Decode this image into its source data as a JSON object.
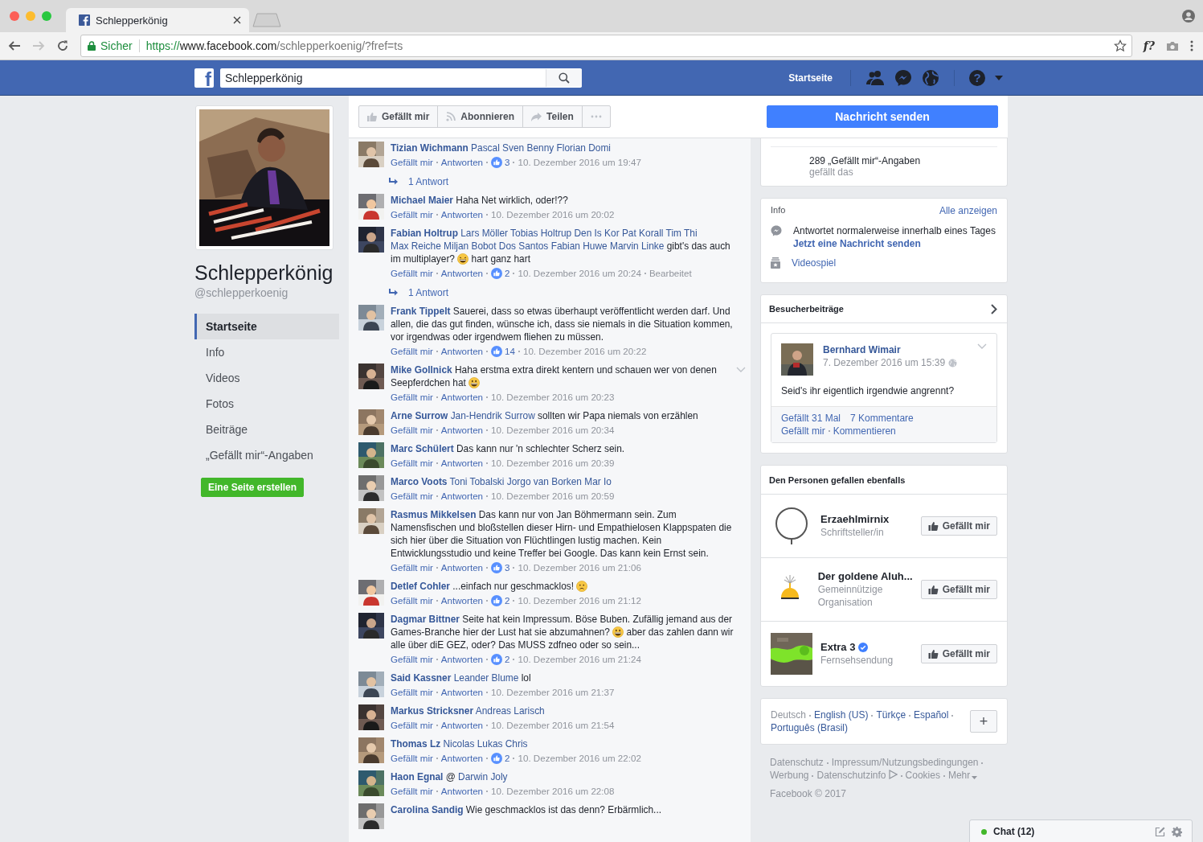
{
  "browser": {
    "tab": {
      "title": "Schlepperkönig"
    },
    "nav_buttons": [
      {
        "kind": "back",
        "disabled": false
      },
      {
        "kind": "forward",
        "disabled": true
      },
      {
        "kind": "reload",
        "disabled": false
      }
    ],
    "security": "Sicher",
    "url": {
      "scheme": "https://",
      "host": "www.facebook.com",
      "path": "/schlepperkoenig/?fref=ts"
    },
    "extension": "f?"
  },
  "topbar": {
    "logo": "f",
    "search": {
      "value": "Schlepperkönig"
    },
    "home": "Startseite",
    "help": "?"
  },
  "page": {
    "name": "Schlepperkönig",
    "handle": "@schlepperkoenig",
    "nav": [
      {
        "label": "Startseite",
        "selected": true
      },
      {
        "label": "Info",
        "selected": false
      },
      {
        "label": "Videos",
        "selected": false
      },
      {
        "label": "Fotos",
        "selected": false
      },
      {
        "label": "Beiträge",
        "selected": false
      },
      {
        "label": "„Gefällt mir“-Angaben",
        "selected": false
      }
    ],
    "create_button": "Eine Seite erstellen"
  },
  "actions": {
    "buttons": [
      {
        "kind": "like",
        "label": "Gefällt mir"
      },
      {
        "kind": "follow",
        "label": "Abonnieren"
      },
      {
        "kind": "share",
        "label": "Teilen"
      },
      {
        "kind": "more"
      }
    ],
    "message_button": "Nachricht senden"
  },
  "comments": [
    {
      "author": "Tizian Wichmann",
      "body": [
        {
          "kind": "mention",
          "text": "Pascal Sven"
        },
        {
          "kind": "mention",
          "text": "Benny Florian"
        },
        {
          "kind": "mention",
          "text": "Domi"
        }
      ],
      "meta": {
        "like": "Gefällt mir",
        "reply": "Antworten",
        "reactions": "3",
        "time": "10. Dezember 2016 um 19:47"
      },
      "replies": "1 Antwort",
      "options_shown": false
    },
    {
      "author": "Michael Maier",
      "body": [
        {
          "kind": "text",
          "text": "Haha Net wirklich, oder!??"
        }
      ],
      "meta": {
        "like": "Gefällt mir",
        "reply": "Antworten",
        "time": "10. Dezember 2016 um 20:02"
      },
      "options_shown": false
    },
    {
      "author": "Fabian Holtrup",
      "body": [
        {
          "kind": "mention",
          "text": "Lars Möller"
        },
        {
          "kind": "mention",
          "text": "Tobias Holtrup"
        },
        {
          "kind": "mention",
          "text": "Den Is Kor"
        },
        {
          "kind": "mention",
          "text": "Pat Korall"
        },
        {
          "kind": "mention",
          "text": "Tim Thi"
        },
        {
          "kind": "mention",
          "text": "Max Reiche"
        },
        {
          "kind": "mention",
          "text": "Miljan Bobot"
        },
        {
          "kind": "mention",
          "text": "Dos Santos"
        },
        {
          "kind": "mention",
          "text": "Fabian Huwe"
        },
        {
          "kind": "mention",
          "text": "Marvin Linke"
        },
        {
          "kind": "text",
          "text": "gibt's das auch im multiplayer?"
        },
        {
          "kind": "laughing"
        },
        {
          "kind": "text",
          "text": "hart ganz hart"
        }
      ],
      "meta": {
        "like": "Gefällt mir",
        "reply": "Antworten",
        "reactions": "2",
        "time": "10. Dezember 2016 um 20:24",
        "edited": "Bearbeitet"
      },
      "replies": "1 Antwort",
      "options_shown": false
    },
    {
      "author": "Frank Tippelt",
      "body": [
        {
          "kind": "text",
          "text": "Sauerei, dass so etwas überhaupt veröffentlicht werden darf. Und allen, die das gut finden, wünsche ich, dass sie niemals in die Situation kommen, vor irgendwas oder irgendwem fliehen zu müssen."
        }
      ],
      "meta": {
        "like": "Gefällt mir",
        "reply": "Antworten",
        "reactions": "14",
        "time": "10. Dezember 2016 um 20:22"
      },
      "options_shown": false
    },
    {
      "author": "Mike Gollnick",
      "body": [
        {
          "kind": "text",
          "text": "Haha erstma extra direkt kentern und schauen wer von denen Seepferdchen hat"
        },
        {
          "kind": "grinning"
        }
      ],
      "meta": {
        "like": "Gefällt mir",
        "reply": "Antworten",
        "time": "10. Dezember 2016 um 20:23"
      },
      "options_shown": true
    },
    {
      "author": "Arne Surrow",
      "body": [
        {
          "kind": "mention",
          "text": "Jan-Hendrik Surrow"
        },
        {
          "kind": "text",
          "text": "sollten wir Papa niemals von erzählen"
        }
      ],
      "meta": {
        "like": "Gefällt mir",
        "reply": "Antworten",
        "time": "10. Dezember 2016 um 20:34"
      },
      "options_shown": false
    },
    {
      "author": "Marc Schülert",
      "body": [
        {
          "kind": "text",
          "text": "Das kann nur 'n schlechter Scherz sein."
        }
      ],
      "meta": {
        "like": "Gefällt mir",
        "reply": "Antworten",
        "time": "10. Dezember 2016 um 20:39"
      },
      "options_shown": false
    },
    {
      "author": "Marco Voots",
      "body": [
        {
          "kind": "mention",
          "text": "Toni Tobalski"
        },
        {
          "kind": "mention",
          "text": "Jorgo van Borken"
        },
        {
          "kind": "mention",
          "text": "Mar Io"
        }
      ],
      "meta": {
        "like": "Gefällt mir",
        "reply": "Antworten",
        "time": "10. Dezember 2016 um 20:59"
      },
      "options_shown": false
    },
    {
      "author": "Rasmus Mikkelsen",
      "body": [
        {
          "kind": "text",
          "text": "Das kann nur von Jan Böhmermann sein. Zum Namensfischen und bloßstellen dieser Hirn- und Empathielosen Klappspaten die sich hier über die Situation von Flüchtlingen lustig machen. Kein Entwicklungsstudio und keine Treffer bei Google. Das kann kein Ernst sein."
        }
      ],
      "meta": {
        "like": "Gefällt mir",
        "reply": "Antworten",
        "reactions": "3",
        "time": "10. Dezember 2016 um 21:06"
      },
      "options_shown": false
    },
    {
      "author": "Detlef Cohler",
      "body": [
        {
          "kind": "text",
          "text": "...einfach nur geschmacklos!"
        },
        {
          "kind": "frowning"
        }
      ],
      "meta": {
        "like": "Gefällt mir",
        "reply": "Antworten",
        "reactions": "2",
        "time": "10. Dezember 2016 um 21:12"
      },
      "options_shown": false
    },
    {
      "author": "Dagmar Bittner",
      "body": [
        {
          "kind": "text",
          "text": "Seite hat kein Impressum. Böse Buben. Zufällig jemand aus der Games-Branche hier der Lust hat sie abzumahnen?"
        },
        {
          "kind": "grinning"
        },
        {
          "kind": "text",
          "text": "aber das zahlen dann wir alle über diE GEZ, oder? Das MUSS zdfneo oder so sein..."
        }
      ],
      "meta": {
        "like": "Gefällt mir",
        "reply": "Antworten",
        "reactions": "2",
        "time": "10. Dezember 2016 um 21:24"
      },
      "options_shown": false
    },
    {
      "author": "Said Kassner",
      "body": [
        {
          "kind": "mention",
          "text": "Leander Blume"
        },
        {
          "kind": "text",
          "text": "lol"
        }
      ],
      "meta": {
        "like": "Gefällt mir",
        "reply": "Antworten",
        "time": "10. Dezember 2016 um 21:37"
      },
      "options_shown": false
    },
    {
      "author": "Markus Stricksner",
      "body": [
        {
          "kind": "mention",
          "text": "Andreas Larisch"
        }
      ],
      "meta": {
        "like": "Gefällt mir",
        "reply": "Antworten",
        "time": "10. Dezember 2016 um 21:54"
      },
      "options_shown": false
    },
    {
      "author": "Thomas Lz",
      "body": [
        {
          "kind": "mention",
          "text": "Nicolas Lukas Chris"
        }
      ],
      "meta": {
        "like": "Gefällt mir",
        "reply": "Antworten",
        "reactions": "2",
        "time": "10. Dezember 2016 um 22:02"
      },
      "options_shown": false
    },
    {
      "author": "Haon Egnal",
      "body": [
        {
          "kind": "text",
          "text": "@"
        },
        {
          "kind": "mention",
          "text": "Darwin Joly"
        }
      ],
      "meta": {
        "like": "Gefällt mir",
        "reply": "Antworten",
        "time": "10. Dezember 2016 um 22:08"
      },
      "options_shown": false
    },
    {
      "author": "Carolina Sandig",
      "body": [
        {
          "kind": "text",
          "text": "Wie geschmacklos ist das denn? Erbärmlich..."
        }
      ],
      "options_shown": false
    }
  ],
  "likes_card": {
    "count": "289 „Gefällt mir“-Angaben",
    "caption": "gefällt das"
  },
  "info": {
    "title": "Info",
    "see_all": "Alle anzeigen",
    "rows": [
      {
        "kind": "response",
        "text": "Antwortet normalerweise innerhalb eines Tages",
        "link": "Jetzt eine Nachricht senden"
      },
      {
        "kind": "category",
        "link": "Videospiel"
      }
    ]
  },
  "visitor_posts": {
    "title": "Besucherbeiträge",
    "post": {
      "author": "Bernhard Wimair",
      "time": "7. Dezember 2016 um 15:39",
      "text": "Seid's ihr eigentlich irgendwie angrennt?",
      "likes": "Gefällt 31 Mal",
      "comments": "7 Kommentare",
      "actions": [
        "Gefällt mir",
        "Kommentieren"
      ]
    }
  },
  "related": {
    "title": "Den Personen gefallen ebenfalls",
    "pages": [
      {
        "kind": "round-logo",
        "name": "Erzaehlmirnix",
        "category": "Schriftsteller/in",
        "verified": false,
        "button": "Gefällt mir"
      },
      {
        "kind": "hat-logo",
        "name": "Der goldene Aluh...",
        "category": "Gemeinnützige Organisation",
        "verified": false,
        "button": "Gefällt mir"
      },
      {
        "kind": "picture",
        "name": "Extra 3",
        "category": "Fernsehsendung",
        "verified": true,
        "button": "Gefällt mir"
      }
    ]
  },
  "languages": {
    "items": [
      {
        "label": "Deutsch",
        "selected": true
      },
      {
        "label": "English (US)",
        "selected": false
      },
      {
        "label": "Türkçe",
        "selected": false
      },
      {
        "label": "Español",
        "selected": false
      },
      {
        "label": "Português (Brasil)",
        "selected": false
      }
    ],
    "more": "+"
  },
  "footer": {
    "links": [
      {
        "kind": "plain",
        "label": "Datenschutz"
      },
      {
        "kind": "plain",
        "label": "Impressum/Nutzungsbedingungen"
      },
      {
        "kind": "plain",
        "label": "Werbung"
      },
      {
        "kind": "adchoices",
        "label": "Datenschutzinfo"
      },
      {
        "kind": "plain",
        "label": "Cookies"
      },
      {
        "kind": "menu",
        "label": "Mehr"
      }
    ],
    "copyright": "Facebook © 2017"
  },
  "chat": {
    "label": "Chat (12)",
    "online": true
  }
}
